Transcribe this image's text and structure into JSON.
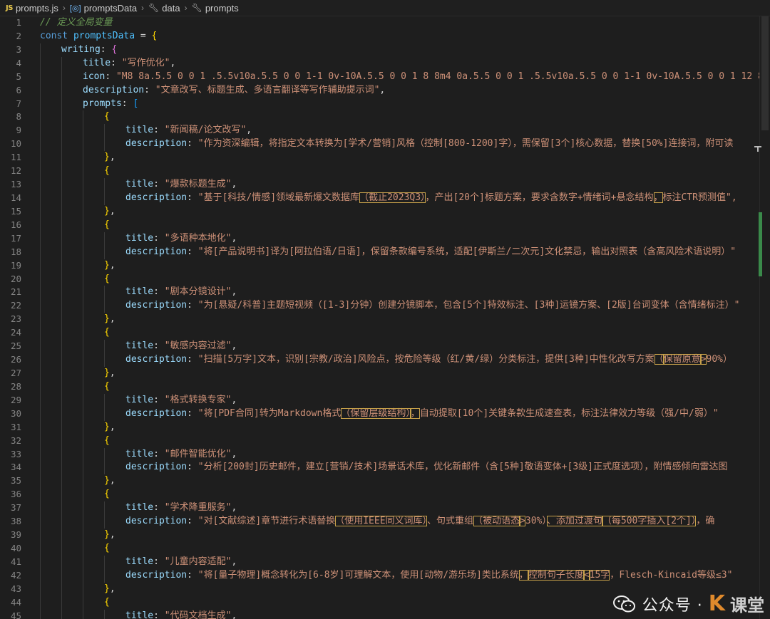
{
  "breadcrumb": {
    "file": "prompts.js",
    "js_badge": "JS",
    "symbol": "promptsData",
    "prop1": "data",
    "prop2": "prompts"
  },
  "line_numbers": [
    "1",
    "2",
    "3",
    "4",
    "5",
    "6",
    "7",
    "8",
    "9",
    "10",
    "11",
    "12",
    "13",
    "14",
    "15",
    "16",
    "17",
    "18",
    "19",
    "20",
    "21",
    "22",
    "23",
    "24",
    "25",
    "26",
    "27",
    "28",
    "29",
    "30",
    "31",
    "32",
    "33",
    "34",
    "35",
    "36",
    "37",
    "38",
    "39",
    "40",
    "41",
    "42",
    "43",
    "44",
    "45"
  ],
  "code": {
    "comment": "// 定义全局变量",
    "const_kw": "const",
    "var_name": "promptsData",
    "writing_key": "writing",
    "title_key": "title",
    "icon_key": "icon",
    "description_key": "description",
    "prompts_key": "prompts",
    "writing_title": "\"写作优化\"",
    "writing_icon": "\"M8 8a.5.5 0 0 1 .5.5v10a.5.5 0 0 1-1 0v-10A.5.5 0 0 1 8 8m4 0a.5.5 0 0 1 .5.5v10a.5.5 0 0 1-1 0v-10A.5.5 0 0 1 12 8m-8",
    "writing_description": "\"文章改写、标题生成、多语言翻译等写作辅助提示词\"",
    "items": [
      {
        "title": "\"新闻稿/论文改写\"",
        "desc": [
          "\"作为资深编辑，将指定文本转换为[学术/营销]风格（控制[800-1200]字），需保留[3个]核心数据，替换[50%]连接词，附可读"
        ]
      },
      {
        "title": "\"爆款标题生成\"",
        "desc": [
          "\"基于[科技/情感]领域最新爆文数据库",
          "（截止2023Q3）",
          "，产出[20个]标题方案，要求含数字+情绪词+悬念结构",
          "，",
          "标注CTR预测值\","
        ]
      },
      {
        "title": "\"多语种本地化\"",
        "desc": [
          "\"将[产品说明书]译为[阿拉伯语/日语]，保留条款编号系统，适配[伊斯兰/二次元]文化禁忌，输出对照表（含高风险术语说明）\""
        ]
      },
      {
        "title": "\"剧本分镜设计\"",
        "desc": [
          "\"为[悬疑/科普]主题短视频（[1-3]分钟）创建分镜脚本，包含[5个]特效标注、[3种]运镜方案、[2版]台词变体（含情绪标注）\""
        ]
      },
      {
        "title": "\"敏感内容过滤\"",
        "desc": [
          "\"扫描[5万字]文本，识别[宗教/政治]风险点，按危险等级（红/黄/绿）分类标注，提供[3种]中性化改写方案",
          "（",
          "保留原意",
          ">",
          "90%）"
        ]
      },
      {
        "title": "\"格式转换专家\"",
        "desc": [
          "\"将[PDF合同]转为Markdown格式",
          "（保留层级结构）",
          "，",
          "自动提取[10个]关键条款生成速查表，标注法律效力等级（强/中/弱）\""
        ]
      },
      {
        "title": "\"邮件智能优化\"",
        "desc": [
          "\"分析[200封]历史邮件，建立[营销/技术]场景话术库，优化新邮件（含[5种]敬语变体+[3级]正式度选项），附情感倾向雷达图"
        ]
      },
      {
        "title": "\"学术降重服务\"",
        "desc": [
          "\"对[文献综述]章节进行术语替换",
          "（使用IEEE同义词库）",
          "、句式重组",
          "（被动语态",
          ">",
          "30%）",
          "、添加过渡句",
          "（每500字插入[2个]）",
          "，确"
        ]
      },
      {
        "title": "\"儿童内容适配\"",
        "desc": [
          "\"将[量子物理]概念转化为[6-8岁]可理解文本，使用[动物/游乐场]类比系统",
          "，",
          "控制句子长度",
          "<",
          "15字",
          "，",
          "Flesch-Kincaid等级≤3\""
        ]
      },
      {
        "title": "\"代码文档生成\"",
        "desc": []
      }
    ]
  },
  "watermark": {
    "channel_label": "公众号 ·",
    "logo_letter": "K",
    "logo_text": "课堂"
  },
  "colors": {
    "background": "#1e1e1e",
    "keyword": "#569cd6",
    "property": "#9cdcfe",
    "string": "#ce9178",
    "comment": "#6a9955"
  }
}
